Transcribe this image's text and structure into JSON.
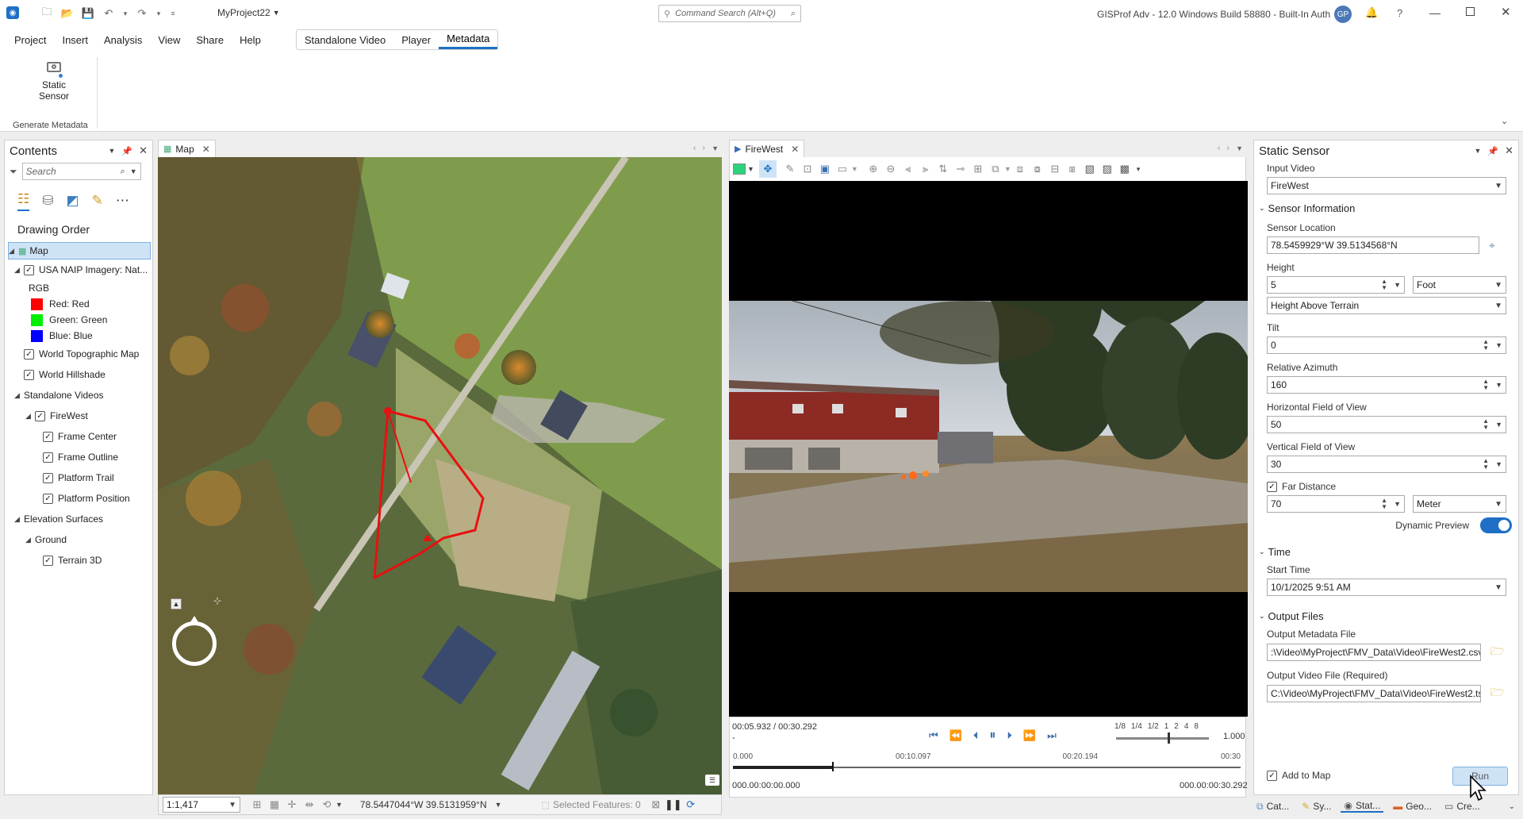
{
  "titlebar": {
    "project_name": "MyProject22",
    "command_search_placeholder": "Command Search (Alt+Q)",
    "app_title": "GISProf Adv - 12.0 Windows Build 58880 - Built-In Auth",
    "user_initials": "GP",
    "help": "?"
  },
  "menu": {
    "items": [
      "Project",
      "Insert",
      "Analysis",
      "View",
      "Share",
      "Help"
    ],
    "context_tabs": [
      "Standalone Video",
      "Player",
      "Metadata"
    ]
  },
  "ribbon": {
    "static_sensor_line1": "Static",
    "static_sensor_line2": "Sensor",
    "group_label": "Generate Metadata"
  },
  "contents": {
    "title": "Contents",
    "search_placeholder": "Search",
    "drawing_order": "Drawing Order",
    "map_item": "Map",
    "naip_layer": "USA NAIP Imagery: Nat...",
    "rgb": "RGB",
    "red_label": "Red:   Red",
    "green_label": "Green:  Green",
    "blue_label": "Blue:  Blue",
    "topo": "World Topographic Map",
    "hillshade": "World Hillshade",
    "standalone_videos": "Standalone Videos",
    "firewest": "FireWest",
    "frame_center": "Frame Center",
    "frame_outline": "Frame Outline",
    "platform_trail": "Platform Trail",
    "platform_position": "Platform Position",
    "elevation_surfaces": "Elevation Surfaces",
    "ground": "Ground",
    "terrain": "Terrain 3D",
    "colors": {
      "red": "#ff0000",
      "green": "#00ee00",
      "blue": "#0000ff"
    }
  },
  "map": {
    "tab_label": "Map",
    "scale": "1:1,417",
    "coords": "78.5447044°W 39.5131959°N",
    "selected_features": "Selected Features: 0"
  },
  "video": {
    "tab_label": "FireWest",
    "time_current": "00:05.932 / 00:30.292",
    "dash": "-",
    "speeds": [
      "1/8",
      "1/4",
      "1/2",
      "1",
      "2",
      "4",
      "8"
    ],
    "speed_value": "1.000",
    "tick_labels": [
      "0.000",
      "00:10.097",
      "00:20.194",
      "00:30"
    ],
    "start_timecode": "000.00:00:00.000",
    "end_timecode": "000.00:00:30.292",
    "progress_fraction": 0.196
  },
  "sensor": {
    "title": "Static Sensor",
    "input_video_label": "Input Video",
    "input_video": "FireWest",
    "sensor_info": "Sensor Information",
    "sensor_location_label": "Sensor Location",
    "sensor_location": "78.5459929°W 39.5134568°N",
    "height_label": "Height",
    "height": "5",
    "height_unit": "Foot",
    "height_mode": "Height Above Terrain",
    "tilt_label": "Tilt",
    "tilt": "0",
    "azimuth_label": "Relative Azimuth",
    "azimuth": "160",
    "hfov_label": "Horizontal Field of View",
    "hfov": "50",
    "vfov_label": "Vertical Field of View",
    "vfov": "30",
    "far_label": "Far Distance",
    "far": "70",
    "far_unit": "Meter",
    "dynamic_preview": "Dynamic Preview",
    "time_section": "Time",
    "start_time_label": "Start Time",
    "start_time": "10/1/2025 9:51 AM",
    "output_section": "Output Files",
    "out_meta_label": "Output Metadata File",
    "out_meta": ":\\Video\\MyProject\\FMV_Data\\Video\\FireWest2.csv",
    "out_video_label": "Output Video File (Required)",
    "out_video": "C:\\Video\\MyProject\\FMV_Data\\Video\\FireWest2.ts",
    "add_to_map": "Add to Map",
    "run": "Run"
  },
  "bottom_tabs": [
    "Cat...",
    "Sy...",
    "Stat...",
    "Geo...",
    "Cre..."
  ]
}
